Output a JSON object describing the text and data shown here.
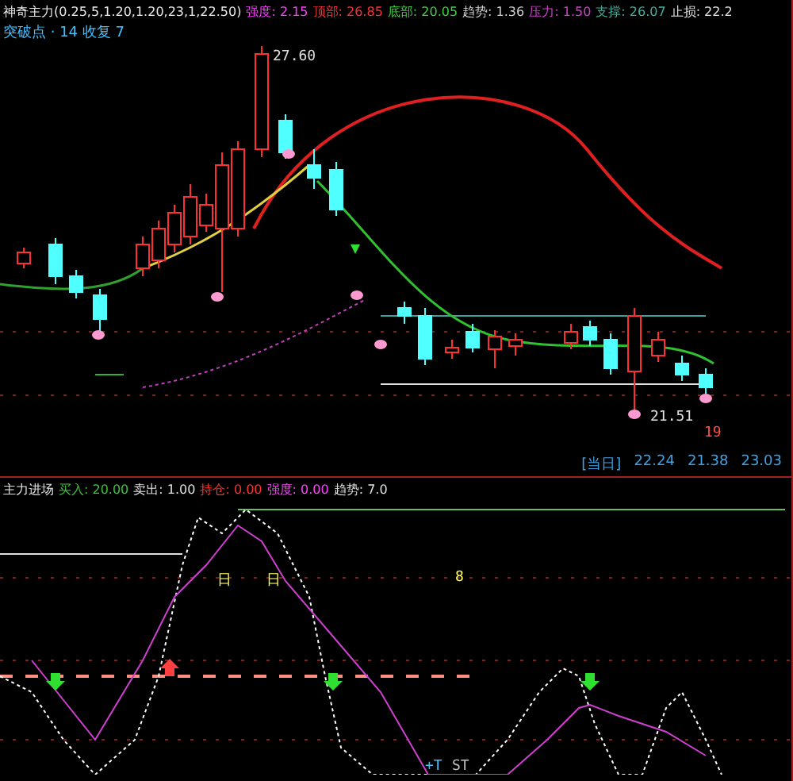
{
  "header": [
    {
      "text": "神奇主力(0.25,5,1.20,1.20,23,1,22.50)",
      "color": "#e8e8e8"
    },
    {
      "text": "强度: 2.15",
      "color": "#ff40ff"
    },
    {
      "text": "顶部: 26.85",
      "color": "#ff3030"
    },
    {
      "text": "底部: 20.05",
      "color": "#40d040"
    },
    {
      "text": "趋势: 1.36",
      "color": "#d0d0d0"
    },
    {
      "text": "压力: 1.50",
      "color": "#d040d0"
    },
    {
      "text": "支撑: 26.07",
      "color": "#40b0a0"
    },
    {
      "text": "止损: 22.2",
      "color": "#e0e0e0"
    }
  ],
  "subtitle": "突破点 · 14 收复 7",
  "main_chart": {
    "high_label": "27.60",
    "low_label": "21.51",
    "count_label": "19"
  },
  "info": {
    "label": "[当日]",
    "values": [
      "22.24",
      "21.38",
      "23.03"
    ]
  },
  "lower_header": [
    {
      "text": "主力进场",
      "color": "#e0e0e0"
    },
    {
      "text": "买入: 20.00",
      "color": "#40c040"
    },
    {
      "text": "卖出: 1.00",
      "color": "#e0e0e0"
    },
    {
      "text": "持仓: 0.00",
      "color": "#ff3030"
    },
    {
      "text": "强度: 0.00",
      "color": "#ff40ff"
    },
    {
      "text": "趋势: 7.0",
      "color": "#e0e0e0"
    }
  ],
  "lower_chart": {
    "marks": [
      {
        "text": "日",
        "color": "#ffff60"
      },
      {
        "text": "日",
        "color": "#ffff60"
      },
      {
        "text": "8",
        "color": "#ffff60"
      },
      {
        "text": "+T",
        "color": "#40c0ff"
      },
      {
        "text": "ST",
        "color": "#c0c0c0"
      }
    ]
  }
}
